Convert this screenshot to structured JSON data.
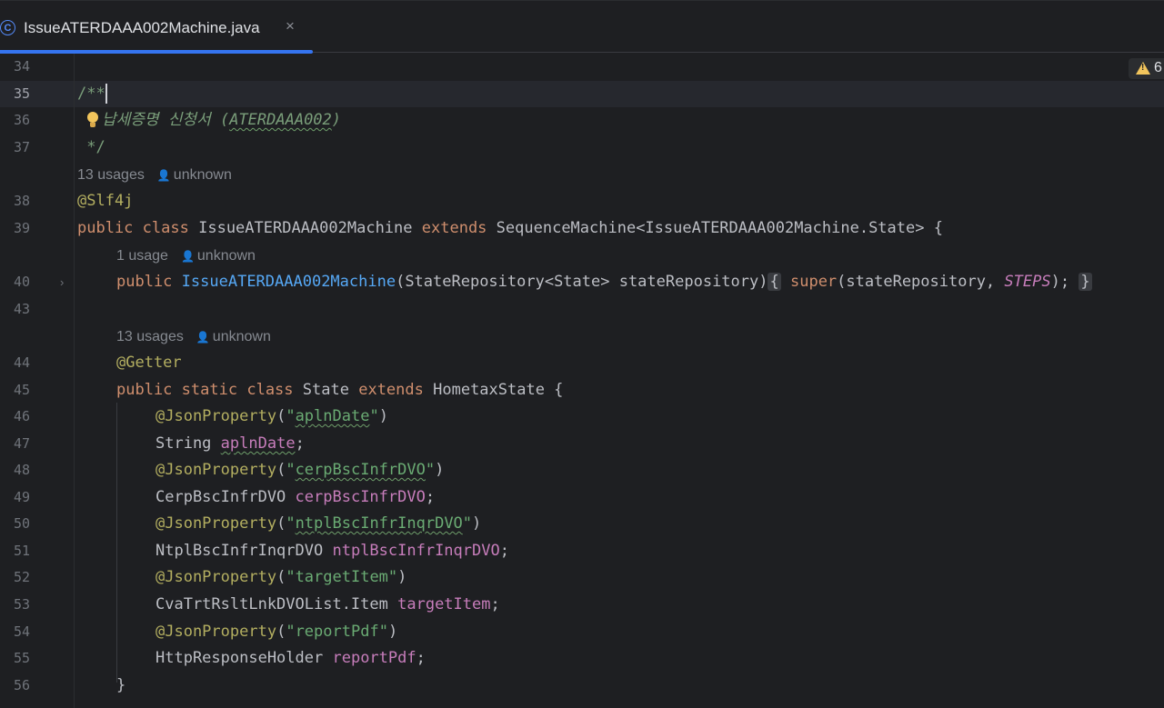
{
  "tab": {
    "icon": "C",
    "title": "IssueATERDAAA002Machine.java",
    "close": "×"
  },
  "warnings": {
    "count": "6"
  },
  "lines": {
    "l34": "34",
    "l35": "35",
    "l36": "36",
    "l37": "37",
    "l38": "38",
    "l39": "39",
    "l40": "40",
    "l43": "43",
    "l44": "44",
    "l45": "45",
    "l46": "46",
    "l47": "47",
    "l48": "48",
    "l49": "49",
    "l50": "50",
    "l51": "51",
    "l52": "52",
    "l53": "53",
    "l54": "54",
    "l55": "55",
    "l56": "56"
  },
  "hints": {
    "class_usages": "13 usages",
    "class_author": "unknown",
    "ctor_usages": "1 usage",
    "ctor_author": "unknown",
    "state_usages": "13 usages",
    "state_author": "unknown"
  },
  "code": {
    "doc_open": "/**",
    "doc_text": "납세증명 신청서 (",
    "doc_id": "ATERDAAA002",
    "doc_close_paren": ")",
    "doc_end": " */",
    "slf4j": "@Slf4j",
    "kw_public": "public",
    "kw_class": "class",
    "kw_extends": "extends",
    "kw_static": "static",
    "kw_super": "super",
    "class_name": "IssueATERDAAA002Machine",
    "superclass": "SequenceMachine<IssueATERDAAA002Machine.State> {",
    "ctor_params": "(StateRepository<State> stateRepository)",
    "ctor_body_args": "(stateRepository, ",
    "steps": "STEPS",
    "ctor_end": ");",
    "brace_open": "{",
    "brace_close": "}",
    "getter": "@Getter",
    "state_name": "State",
    "hometax": "HometaxState {",
    "json_prop": "@JsonProperty",
    "lp": "(",
    "rp": ")",
    "q": "\"",
    "apln_date": "aplnDate",
    "type_string": "String",
    "cerp": "cerpBscInfrDVO",
    "type_cerp": "CerpBscInfrDVO",
    "ntpl": "ntplBscInfrInqrDVO",
    "type_ntpl": "NtplBscInfrInqrDVO",
    "target": "targetItem",
    "type_target": "CvaTrtRsltLnkDVOList.Item",
    "report": "reportPdf",
    "type_report": "HttpResponseHolder",
    "semi": ";"
  }
}
